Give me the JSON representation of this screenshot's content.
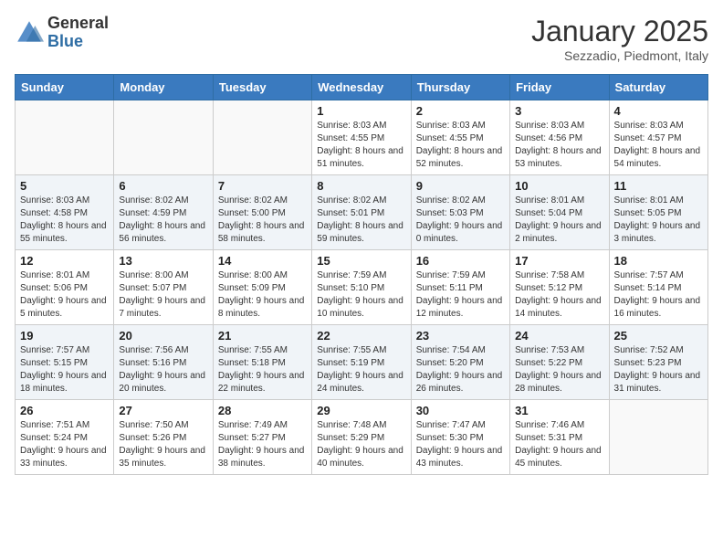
{
  "header": {
    "logo_general": "General",
    "logo_blue": "Blue",
    "month_title": "January 2025",
    "subtitle": "Sezzadio, Piedmont, Italy"
  },
  "days_of_week": [
    "Sunday",
    "Monday",
    "Tuesday",
    "Wednesday",
    "Thursday",
    "Friday",
    "Saturday"
  ],
  "weeks": [
    {
      "shaded": false,
      "days": [
        {
          "num": "",
          "info": ""
        },
        {
          "num": "",
          "info": ""
        },
        {
          "num": "",
          "info": ""
        },
        {
          "num": "1",
          "info": "Sunrise: 8:03 AM\nSunset: 4:55 PM\nDaylight: 8 hours and 51 minutes."
        },
        {
          "num": "2",
          "info": "Sunrise: 8:03 AM\nSunset: 4:55 PM\nDaylight: 8 hours and 52 minutes."
        },
        {
          "num": "3",
          "info": "Sunrise: 8:03 AM\nSunset: 4:56 PM\nDaylight: 8 hours and 53 minutes."
        },
        {
          "num": "4",
          "info": "Sunrise: 8:03 AM\nSunset: 4:57 PM\nDaylight: 8 hours and 54 minutes."
        }
      ]
    },
    {
      "shaded": true,
      "days": [
        {
          "num": "5",
          "info": "Sunrise: 8:03 AM\nSunset: 4:58 PM\nDaylight: 8 hours and 55 minutes."
        },
        {
          "num": "6",
          "info": "Sunrise: 8:02 AM\nSunset: 4:59 PM\nDaylight: 8 hours and 56 minutes."
        },
        {
          "num": "7",
          "info": "Sunrise: 8:02 AM\nSunset: 5:00 PM\nDaylight: 8 hours and 58 minutes."
        },
        {
          "num": "8",
          "info": "Sunrise: 8:02 AM\nSunset: 5:01 PM\nDaylight: 8 hours and 59 minutes."
        },
        {
          "num": "9",
          "info": "Sunrise: 8:02 AM\nSunset: 5:03 PM\nDaylight: 9 hours and 0 minutes."
        },
        {
          "num": "10",
          "info": "Sunrise: 8:01 AM\nSunset: 5:04 PM\nDaylight: 9 hours and 2 minutes."
        },
        {
          "num": "11",
          "info": "Sunrise: 8:01 AM\nSunset: 5:05 PM\nDaylight: 9 hours and 3 minutes."
        }
      ]
    },
    {
      "shaded": false,
      "days": [
        {
          "num": "12",
          "info": "Sunrise: 8:01 AM\nSunset: 5:06 PM\nDaylight: 9 hours and 5 minutes."
        },
        {
          "num": "13",
          "info": "Sunrise: 8:00 AM\nSunset: 5:07 PM\nDaylight: 9 hours and 7 minutes."
        },
        {
          "num": "14",
          "info": "Sunrise: 8:00 AM\nSunset: 5:09 PM\nDaylight: 9 hours and 8 minutes."
        },
        {
          "num": "15",
          "info": "Sunrise: 7:59 AM\nSunset: 5:10 PM\nDaylight: 9 hours and 10 minutes."
        },
        {
          "num": "16",
          "info": "Sunrise: 7:59 AM\nSunset: 5:11 PM\nDaylight: 9 hours and 12 minutes."
        },
        {
          "num": "17",
          "info": "Sunrise: 7:58 AM\nSunset: 5:12 PM\nDaylight: 9 hours and 14 minutes."
        },
        {
          "num": "18",
          "info": "Sunrise: 7:57 AM\nSunset: 5:14 PM\nDaylight: 9 hours and 16 minutes."
        }
      ]
    },
    {
      "shaded": true,
      "days": [
        {
          "num": "19",
          "info": "Sunrise: 7:57 AM\nSunset: 5:15 PM\nDaylight: 9 hours and 18 minutes."
        },
        {
          "num": "20",
          "info": "Sunrise: 7:56 AM\nSunset: 5:16 PM\nDaylight: 9 hours and 20 minutes."
        },
        {
          "num": "21",
          "info": "Sunrise: 7:55 AM\nSunset: 5:18 PM\nDaylight: 9 hours and 22 minutes."
        },
        {
          "num": "22",
          "info": "Sunrise: 7:55 AM\nSunset: 5:19 PM\nDaylight: 9 hours and 24 minutes."
        },
        {
          "num": "23",
          "info": "Sunrise: 7:54 AM\nSunset: 5:20 PM\nDaylight: 9 hours and 26 minutes."
        },
        {
          "num": "24",
          "info": "Sunrise: 7:53 AM\nSunset: 5:22 PM\nDaylight: 9 hours and 28 minutes."
        },
        {
          "num": "25",
          "info": "Sunrise: 7:52 AM\nSunset: 5:23 PM\nDaylight: 9 hours and 31 minutes."
        }
      ]
    },
    {
      "shaded": false,
      "days": [
        {
          "num": "26",
          "info": "Sunrise: 7:51 AM\nSunset: 5:24 PM\nDaylight: 9 hours and 33 minutes."
        },
        {
          "num": "27",
          "info": "Sunrise: 7:50 AM\nSunset: 5:26 PM\nDaylight: 9 hours and 35 minutes."
        },
        {
          "num": "28",
          "info": "Sunrise: 7:49 AM\nSunset: 5:27 PM\nDaylight: 9 hours and 38 minutes."
        },
        {
          "num": "29",
          "info": "Sunrise: 7:48 AM\nSunset: 5:29 PM\nDaylight: 9 hours and 40 minutes."
        },
        {
          "num": "30",
          "info": "Sunrise: 7:47 AM\nSunset: 5:30 PM\nDaylight: 9 hours and 43 minutes."
        },
        {
          "num": "31",
          "info": "Sunrise: 7:46 AM\nSunset: 5:31 PM\nDaylight: 9 hours and 45 minutes."
        },
        {
          "num": "",
          "info": ""
        }
      ]
    }
  ]
}
